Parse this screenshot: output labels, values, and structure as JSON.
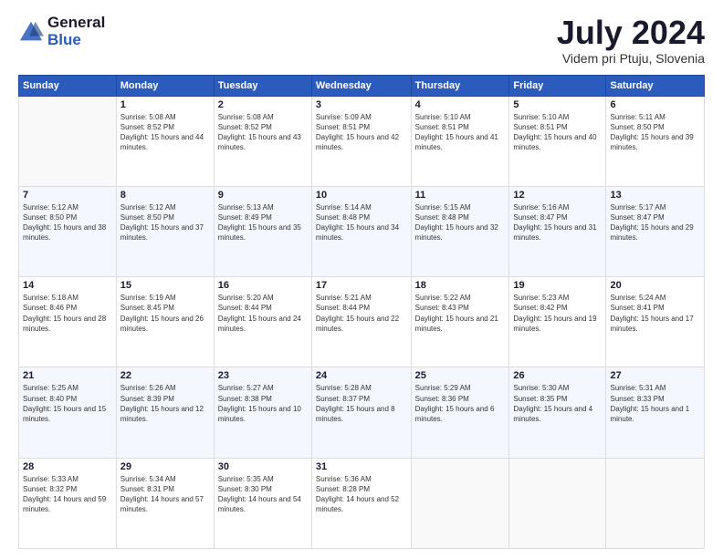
{
  "header": {
    "logo_general": "General",
    "logo_blue": "Blue",
    "month_title": "July 2024",
    "location": "Videm pri Ptuju, Slovenia"
  },
  "weekdays": [
    "Sunday",
    "Monday",
    "Tuesday",
    "Wednesday",
    "Thursday",
    "Friday",
    "Saturday"
  ],
  "weeks": [
    [
      {
        "day": "",
        "sunrise": "",
        "sunset": "",
        "daylight": ""
      },
      {
        "day": "1",
        "sunrise": "Sunrise: 5:08 AM",
        "sunset": "Sunset: 8:52 PM",
        "daylight": "Daylight: 15 hours and 44 minutes."
      },
      {
        "day": "2",
        "sunrise": "Sunrise: 5:08 AM",
        "sunset": "Sunset: 8:52 PM",
        "daylight": "Daylight: 15 hours and 43 minutes."
      },
      {
        "day": "3",
        "sunrise": "Sunrise: 5:09 AM",
        "sunset": "Sunset: 8:51 PM",
        "daylight": "Daylight: 15 hours and 42 minutes."
      },
      {
        "day": "4",
        "sunrise": "Sunrise: 5:10 AM",
        "sunset": "Sunset: 8:51 PM",
        "daylight": "Daylight: 15 hours and 41 minutes."
      },
      {
        "day": "5",
        "sunrise": "Sunrise: 5:10 AM",
        "sunset": "Sunset: 8:51 PM",
        "daylight": "Daylight: 15 hours and 40 minutes."
      },
      {
        "day": "6",
        "sunrise": "Sunrise: 5:11 AM",
        "sunset": "Sunset: 8:50 PM",
        "daylight": "Daylight: 15 hours and 39 minutes."
      }
    ],
    [
      {
        "day": "7",
        "sunrise": "Sunrise: 5:12 AM",
        "sunset": "Sunset: 8:50 PM",
        "daylight": "Daylight: 15 hours and 38 minutes."
      },
      {
        "day": "8",
        "sunrise": "Sunrise: 5:12 AM",
        "sunset": "Sunset: 8:50 PM",
        "daylight": "Daylight: 15 hours and 37 minutes."
      },
      {
        "day": "9",
        "sunrise": "Sunrise: 5:13 AM",
        "sunset": "Sunset: 8:49 PM",
        "daylight": "Daylight: 15 hours and 35 minutes."
      },
      {
        "day": "10",
        "sunrise": "Sunrise: 5:14 AM",
        "sunset": "Sunset: 8:48 PM",
        "daylight": "Daylight: 15 hours and 34 minutes."
      },
      {
        "day": "11",
        "sunrise": "Sunrise: 5:15 AM",
        "sunset": "Sunset: 8:48 PM",
        "daylight": "Daylight: 15 hours and 32 minutes."
      },
      {
        "day": "12",
        "sunrise": "Sunrise: 5:16 AM",
        "sunset": "Sunset: 8:47 PM",
        "daylight": "Daylight: 15 hours and 31 minutes."
      },
      {
        "day": "13",
        "sunrise": "Sunrise: 5:17 AM",
        "sunset": "Sunset: 8:47 PM",
        "daylight": "Daylight: 15 hours and 29 minutes."
      }
    ],
    [
      {
        "day": "14",
        "sunrise": "Sunrise: 5:18 AM",
        "sunset": "Sunset: 8:46 PM",
        "daylight": "Daylight: 15 hours and 28 minutes."
      },
      {
        "day": "15",
        "sunrise": "Sunrise: 5:19 AM",
        "sunset": "Sunset: 8:45 PM",
        "daylight": "Daylight: 15 hours and 26 minutes."
      },
      {
        "day": "16",
        "sunrise": "Sunrise: 5:20 AM",
        "sunset": "Sunset: 8:44 PM",
        "daylight": "Daylight: 15 hours and 24 minutes."
      },
      {
        "day": "17",
        "sunrise": "Sunrise: 5:21 AM",
        "sunset": "Sunset: 8:44 PM",
        "daylight": "Daylight: 15 hours and 22 minutes."
      },
      {
        "day": "18",
        "sunrise": "Sunrise: 5:22 AM",
        "sunset": "Sunset: 8:43 PM",
        "daylight": "Daylight: 15 hours and 21 minutes."
      },
      {
        "day": "19",
        "sunrise": "Sunrise: 5:23 AM",
        "sunset": "Sunset: 8:42 PM",
        "daylight": "Daylight: 15 hours and 19 minutes."
      },
      {
        "day": "20",
        "sunrise": "Sunrise: 5:24 AM",
        "sunset": "Sunset: 8:41 PM",
        "daylight": "Daylight: 15 hours and 17 minutes."
      }
    ],
    [
      {
        "day": "21",
        "sunrise": "Sunrise: 5:25 AM",
        "sunset": "Sunset: 8:40 PM",
        "daylight": "Daylight: 15 hours and 15 minutes."
      },
      {
        "day": "22",
        "sunrise": "Sunrise: 5:26 AM",
        "sunset": "Sunset: 8:39 PM",
        "daylight": "Daylight: 15 hours and 12 minutes."
      },
      {
        "day": "23",
        "sunrise": "Sunrise: 5:27 AM",
        "sunset": "Sunset: 8:38 PM",
        "daylight": "Daylight: 15 hours and 10 minutes."
      },
      {
        "day": "24",
        "sunrise": "Sunrise: 5:28 AM",
        "sunset": "Sunset: 8:37 PM",
        "daylight": "Daylight: 15 hours and 8 minutes."
      },
      {
        "day": "25",
        "sunrise": "Sunrise: 5:29 AM",
        "sunset": "Sunset: 8:36 PM",
        "daylight": "Daylight: 15 hours and 6 minutes."
      },
      {
        "day": "26",
        "sunrise": "Sunrise: 5:30 AM",
        "sunset": "Sunset: 8:35 PM",
        "daylight": "Daylight: 15 hours and 4 minutes."
      },
      {
        "day": "27",
        "sunrise": "Sunrise: 5:31 AM",
        "sunset": "Sunset: 8:33 PM",
        "daylight": "Daylight: 15 hours and 1 minute."
      }
    ],
    [
      {
        "day": "28",
        "sunrise": "Sunrise: 5:33 AM",
        "sunset": "Sunset: 8:32 PM",
        "daylight": "Daylight: 14 hours and 59 minutes."
      },
      {
        "day": "29",
        "sunrise": "Sunrise: 5:34 AM",
        "sunset": "Sunset: 8:31 PM",
        "daylight": "Daylight: 14 hours and 57 minutes."
      },
      {
        "day": "30",
        "sunrise": "Sunrise: 5:35 AM",
        "sunset": "Sunset: 8:30 PM",
        "daylight": "Daylight: 14 hours and 54 minutes."
      },
      {
        "day": "31",
        "sunrise": "Sunrise: 5:36 AM",
        "sunset": "Sunset: 8:28 PM",
        "daylight": "Daylight: 14 hours and 52 minutes."
      },
      {
        "day": "",
        "sunrise": "",
        "sunset": "",
        "daylight": ""
      },
      {
        "day": "",
        "sunrise": "",
        "sunset": "",
        "daylight": ""
      },
      {
        "day": "",
        "sunrise": "",
        "sunset": "",
        "daylight": ""
      }
    ]
  ]
}
